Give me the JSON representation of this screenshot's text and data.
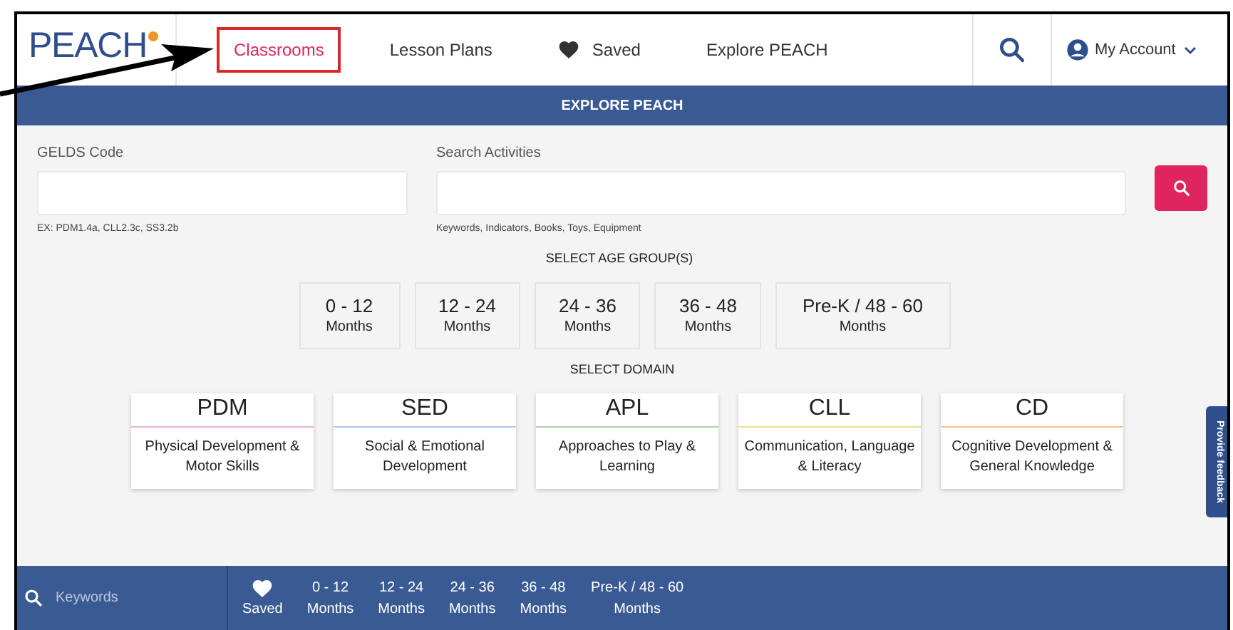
{
  "logo": {
    "text": "PEACH"
  },
  "nav": [
    {
      "label": "Classrooms",
      "selected": true,
      "highlighted": true,
      "kind": "link"
    },
    {
      "label": "Lesson Plans",
      "selected": false,
      "highlighted": false,
      "kind": "link"
    },
    {
      "label": "Saved",
      "selected": false,
      "highlighted": false,
      "kind": "heart"
    },
    {
      "label": "Explore PEACH",
      "selected": false,
      "highlighted": false,
      "kind": "link"
    }
  ],
  "account": {
    "label": "My Account"
  },
  "banner": {
    "title": "EXPLORE PEACH"
  },
  "geld_field": {
    "label": "GELDS Code",
    "hint": "EX: PDM1.4a, CLL2.3c, SS3.2b"
  },
  "search_field": {
    "label": "Search Activities",
    "hint": "Keywords, Indicators, Books, Toys, Equipment"
  },
  "age_heading": "SELECT AGE GROUP(S)",
  "age_groups": [
    {
      "range": "0 - 12",
      "unit": "Months",
      "selected": false
    },
    {
      "range": "12 - 24",
      "unit": "Months",
      "selected": false
    },
    {
      "range": "24 - 36",
      "unit": "Months",
      "selected": false
    },
    {
      "range": "36 - 48",
      "unit": "Months",
      "selected": false
    },
    {
      "range": "Pre-K / 48 - 60",
      "unit": "Months",
      "selected": false
    }
  ],
  "domain_heading": "SELECT DOMAIN",
  "domains": [
    {
      "code": "PDM",
      "name": "Physical Development & Motor Skills",
      "color": "#e8b4e0"
    },
    {
      "code": "SED",
      "name": "Social & Emotional Development",
      "color": "#a9cdec"
    },
    {
      "code": "APL",
      "name": "Approaches to Play & Learning",
      "color": "#a6d6a0"
    },
    {
      "code": "CLL",
      "name": "Communication, Language & Literacy",
      "color": "#f6dc8a"
    },
    {
      "code": "CD",
      "name": "Cognitive Development & General Knowledge",
      "color": "#f5c28a"
    }
  ],
  "feedback_tab": "Provide feedback",
  "bottom_bar": {
    "placeholder": "Keywords",
    "saved": "Saved",
    "ages": [
      {
        "range": "0 - 12",
        "unit": "Months"
      },
      {
        "range": "12 - 24",
        "unit": "Months"
      },
      {
        "range": "24 - 36",
        "unit": "Months"
      },
      {
        "range": "36 - 48",
        "unit": "Months"
      },
      {
        "range": "Pre-K / 48 - 60",
        "unit": "Months"
      }
    ]
  }
}
